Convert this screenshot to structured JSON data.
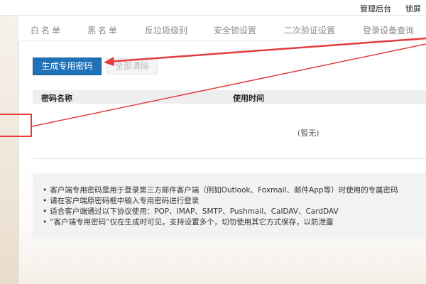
{
  "header": {
    "admin_label": "管理后台",
    "lock_label": "锁屏"
  },
  "tabs": [
    {
      "label": "白名单"
    },
    {
      "label": "黑名单"
    },
    {
      "label": "反垃圾级别"
    },
    {
      "label": "安全锁设置"
    },
    {
      "label": "二次验证设置"
    },
    {
      "label": "登录设备查询"
    }
  ],
  "actions": {
    "generate_label": "生成专用密码",
    "clear_all_label": "全部清除"
  },
  "table": {
    "columns": [
      "密码名称",
      "使用时间"
    ],
    "empty_text": "(暂无)"
  },
  "notes": [
    "客户端专用密码是用于登录第三方邮件客户端（例如Outlook、Foxmail、邮件App等）时使用的专属密码",
    "请在客户端原密码框中输入专用密码进行登录",
    "适合客户端通过以下协议使用：POP、IMAP、SMTP、Pushmail、CalDAV、CardDAV",
    "“客户端专用密码”仅在生成时可见，支持设置多个，切勿使用其它方式保存，以防泄露"
  ],
  "colors": {
    "primary": "#1f72b8",
    "annotation": "#e23d3d"
  }
}
